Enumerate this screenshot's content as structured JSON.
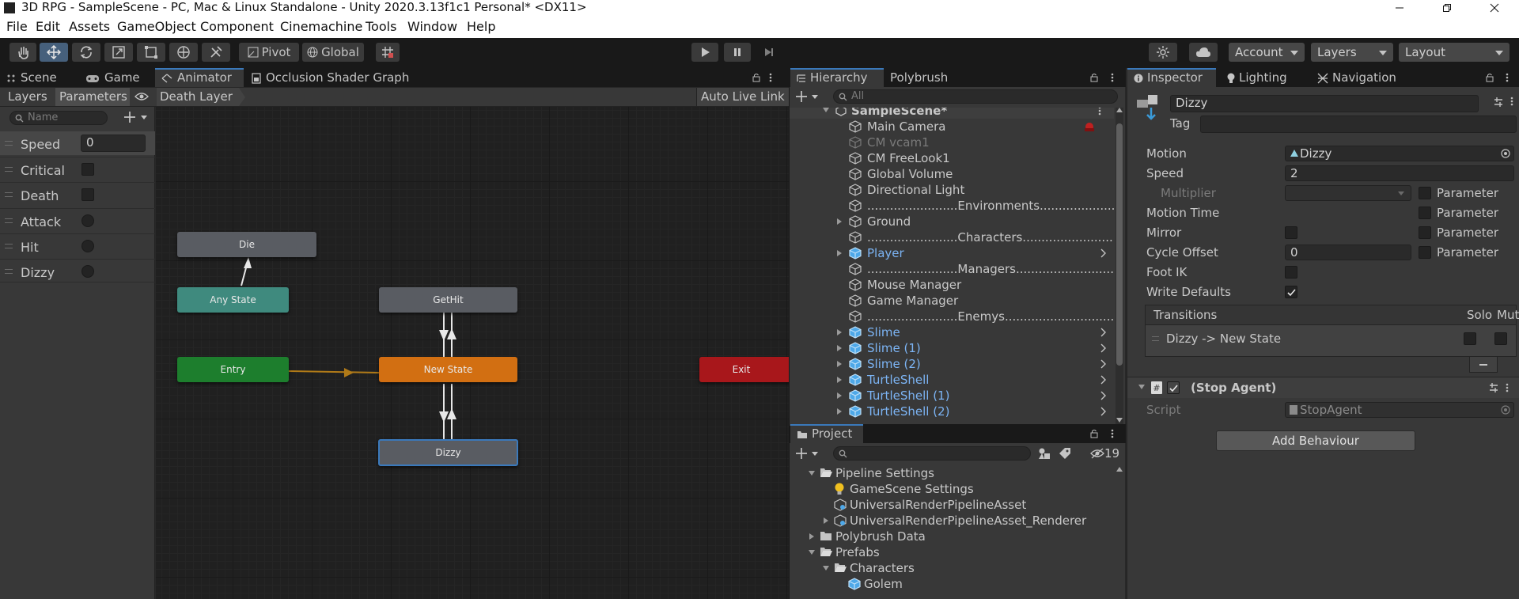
{
  "window": {
    "title": "3D RPG - SampleScene - PC, Mac & Linux Standalone - Unity 2020.3.13f1c1 Personal* <DX11>"
  },
  "menu": [
    "File",
    "Edit",
    "Assets",
    "GameObject",
    "Component",
    "Cinemachine",
    "Tools",
    "Window",
    "Help"
  ],
  "toolbar": {
    "pivot": "Pivot",
    "global": "Global",
    "account": "Account",
    "layers": "Layers",
    "layout": "Layout"
  },
  "left_tabs": [
    "Scene",
    "Game",
    "Animator",
    "Occlusion Shader Graph"
  ],
  "animator": {
    "layers_tab": "Layers",
    "params_tab": "Parameters",
    "breadcrumb": "Death Layer",
    "auto_live_link": "Auto Live Link",
    "search_placeholder": "Name",
    "parameters": [
      {
        "name": "Speed",
        "type": "float",
        "value": "0"
      },
      {
        "name": "Critical",
        "type": "bool"
      },
      {
        "name": "Death",
        "type": "bool"
      },
      {
        "name": "Attack",
        "type": "trigger"
      },
      {
        "name": "Hit",
        "type": "trigger"
      },
      {
        "name": "Dizzy",
        "type": "trigger"
      }
    ],
    "states": {
      "die": "Die",
      "any": "Any State",
      "gethit": "GetHit",
      "entry": "Entry",
      "newstate": "New State",
      "exit": "Exit",
      "dizzy": "Dizzy"
    }
  },
  "colors": {
    "entry": "#1d7e2d",
    "any_state": "#3f8a7e",
    "default_state": "#d26f12",
    "exit": "#a8171b",
    "selected": "#3a79bb"
  },
  "hierarchy": {
    "tabs": [
      "Hierarchy",
      "Polybrush"
    ],
    "search_placeholder": "All",
    "scene": "SampleScene*",
    "items": [
      {
        "name": "Main Camera",
        "kind": "normal"
      },
      {
        "name": "CM vcam1",
        "kind": "disabled"
      },
      {
        "name": "CM FreeLook1",
        "kind": "normal"
      },
      {
        "name": "Global Volume",
        "kind": "normal"
      },
      {
        "name": "Directional Light",
        "kind": "normal"
      },
      {
        "name": "........................Environments..............................",
        "kind": "normal"
      },
      {
        "name": "Ground",
        "kind": "normal",
        "fold": true
      },
      {
        "name": "........................Characters..................................",
        "kind": "normal"
      },
      {
        "name": "Player",
        "kind": "prefab",
        "fold": true,
        "arrow": true
      },
      {
        "name": "........................Managers.................................",
        "kind": "normal"
      },
      {
        "name": "Mouse Manager",
        "kind": "normal"
      },
      {
        "name": "Game Manager",
        "kind": "normal"
      },
      {
        "name": "........................Enemys.................................",
        "kind": "normal"
      },
      {
        "name": "Slime",
        "kind": "prefab",
        "fold": true,
        "arrow": true
      },
      {
        "name": "Slime (1)",
        "kind": "prefab",
        "fold": true,
        "arrow": true
      },
      {
        "name": "Slime (2)",
        "kind": "prefab",
        "fold": true,
        "arrow": true
      },
      {
        "name": "TurtleShell",
        "kind": "prefab",
        "fold": true,
        "arrow": true
      },
      {
        "name": "TurtleShell (1)",
        "kind": "prefab",
        "fold": true,
        "arrow": true
      },
      {
        "name": "TurtleShell (2)",
        "kind": "prefab",
        "fold": true,
        "arrow": true
      }
    ]
  },
  "project": {
    "tab": "Project",
    "hidden_count": "19",
    "items": [
      {
        "name": "Pipeline Settings",
        "depth": 0,
        "icon": "folder-open",
        "fold": "open"
      },
      {
        "name": "GameScene Settings",
        "depth": 1,
        "icon": "bulb"
      },
      {
        "name": "UniversalRenderPipelineAsset",
        "depth": 1,
        "icon": "asset"
      },
      {
        "name": "UniversalRenderPipelineAsset_Renderer",
        "depth": 1,
        "icon": "asset",
        "fold": "closed"
      },
      {
        "name": "Polybrush Data",
        "depth": 0,
        "icon": "folder",
        "fold": "closed"
      },
      {
        "name": "Prefabs",
        "depth": 0,
        "icon": "folder-open",
        "fold": "open"
      },
      {
        "name": "Characters",
        "depth": 1,
        "icon": "folder-open",
        "fold": "open"
      },
      {
        "name": "Golem",
        "depth": 2,
        "icon": "prefab"
      }
    ]
  },
  "inspector": {
    "tabs": [
      "Inspector",
      "Lighting",
      "Navigation"
    ],
    "name": "Dizzy",
    "tag_label": "Tag",
    "motion_label": "Motion",
    "motion_value": "Dizzy",
    "speed_label": "Speed",
    "speed_value": "2",
    "multiplier_label": "Multiplier",
    "motion_time_label": "Motion Time",
    "mirror_label": "Mirror",
    "cycle_offset_label": "Cycle Offset",
    "cycle_offset_value": "0",
    "foot_ik_label": "Foot IK",
    "write_defaults_label": "Write Defaults",
    "parameter_label": "Parameter",
    "transitions_label": "Transitions",
    "solo_label": "Solo",
    "mute_label": "Mute",
    "transition_item": "Dizzy -> New State",
    "component_name": "(Stop Agent)",
    "script_label": "Script",
    "script_value": "StopAgent",
    "add_behaviour": "Add Behaviour"
  }
}
